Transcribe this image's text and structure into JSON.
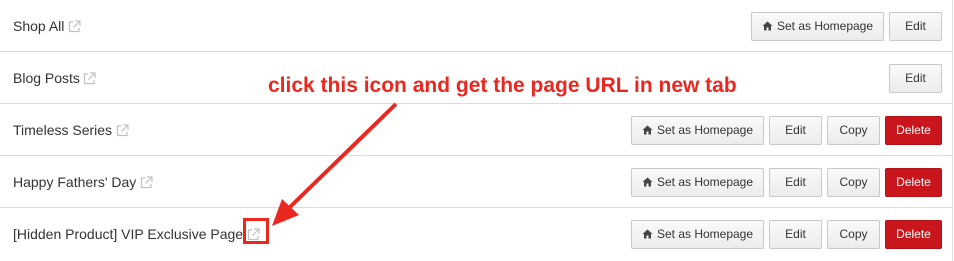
{
  "pages": [
    {
      "title": "Shop All",
      "buttons": {
        "home": "Set as Homepage",
        "edit": "Edit"
      }
    },
    {
      "title": "Blog Posts",
      "buttons": {
        "edit": "Edit"
      }
    },
    {
      "title": "Timeless Series",
      "buttons": {
        "home": "Set as Homepage",
        "edit": "Edit",
        "copy": "Copy",
        "delete": "Delete"
      }
    },
    {
      "title": "Happy Fathers' Day",
      "buttons": {
        "home": "Set as Homepage",
        "edit": "Edit",
        "copy": "Copy",
        "delete": "Delete"
      }
    },
    {
      "title": "[Hidden Product] VIP Exclusive Page",
      "buttons": {
        "home": "Set as Homepage",
        "edit": "Edit",
        "copy": "Copy",
        "delete": "Delete"
      }
    }
  ],
  "annotation": {
    "text": "click this icon and get the page URL in new tab",
    "color": "#ea2820"
  },
  "icons": {
    "external": "external-link-icon",
    "home": "home-icon"
  },
  "colors": {
    "delete": "#c9161d",
    "border": "#dddddd",
    "text": "#333333"
  }
}
